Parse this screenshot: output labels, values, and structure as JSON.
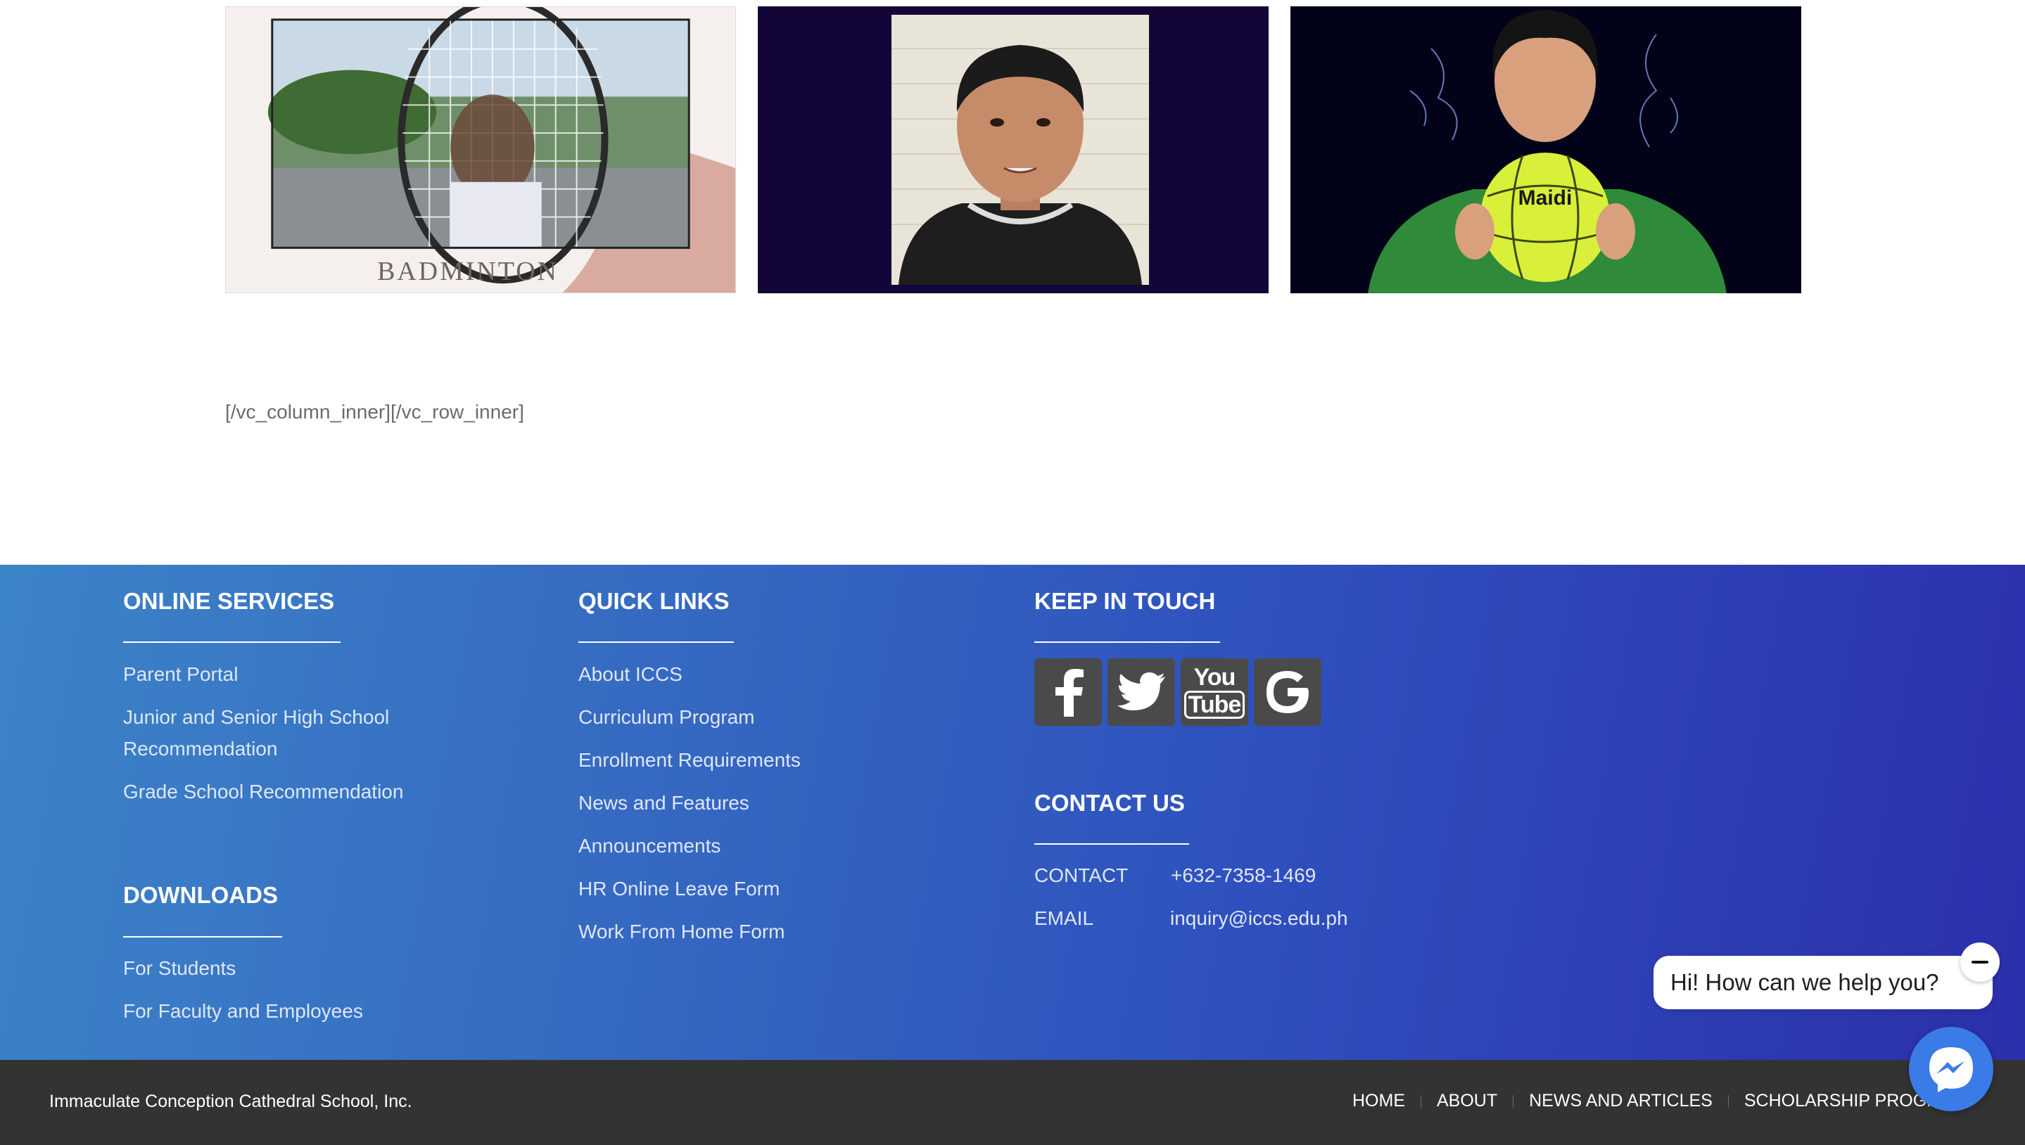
{
  "thumbnails": [
    {
      "name": "badminton-video-thumbnail",
      "caption": "BADMINTON"
    },
    {
      "name": "student-speaking-video-thumbnail"
    },
    {
      "name": "volleyball-video-thumbnail",
      "ball_brand": "Maidi"
    }
  ],
  "shortcode_text": "[/vc_column_inner][/vc_row_inner]",
  "footer": {
    "online_services": {
      "heading": "ONLINE SERVICES",
      "links": [
        "Parent Portal",
        "Junior and Senior High School",
        "Recommendation",
        "Grade School Recommendation"
      ]
    },
    "downloads": {
      "heading": "DOWNLOADS",
      "links": [
        "For Students",
        "For Faculty and Employees"
      ]
    },
    "quick_links": {
      "heading": "QUICK LINKS",
      "links": [
        "About ICCS",
        "Curriculum Program",
        "Enrollment Requirements",
        "News and Features",
        "Announcements",
        "HR Online Leave Form",
        "Work From Home Form"
      ]
    },
    "keep_in_touch": {
      "heading": "KEEP IN TOUCH",
      "social": [
        {
          "icon": "facebook-icon"
        },
        {
          "icon": "twitter-icon"
        },
        {
          "icon": "youtube-icon",
          "text_top": "You",
          "text_bottom": "Tube"
        },
        {
          "icon": "google-icon"
        }
      ]
    },
    "contact_us": {
      "heading": "CONTACT US",
      "contact_label": "CONTACT",
      "contact_value": "+632-7358-1469",
      "email_label": "EMAIL",
      "email_value": "inquiry@iccs.edu.ph"
    }
  },
  "bottom_bar": {
    "copyright": "Immaculate Conception Cathedral School, Inc.",
    "nav": [
      "HOME",
      "ABOUT",
      "NEWS AND ARTICLES",
      "SCHOLARSHIP PROGRAM"
    ]
  },
  "chat": {
    "greeting": "Hi! How can we help you?"
  },
  "colors": {
    "footer_gradient_start": "#3c84c8",
    "footer_gradient_end": "#2c2fab",
    "bottom_bar": "#333333",
    "messenger": "#3b7be8"
  }
}
